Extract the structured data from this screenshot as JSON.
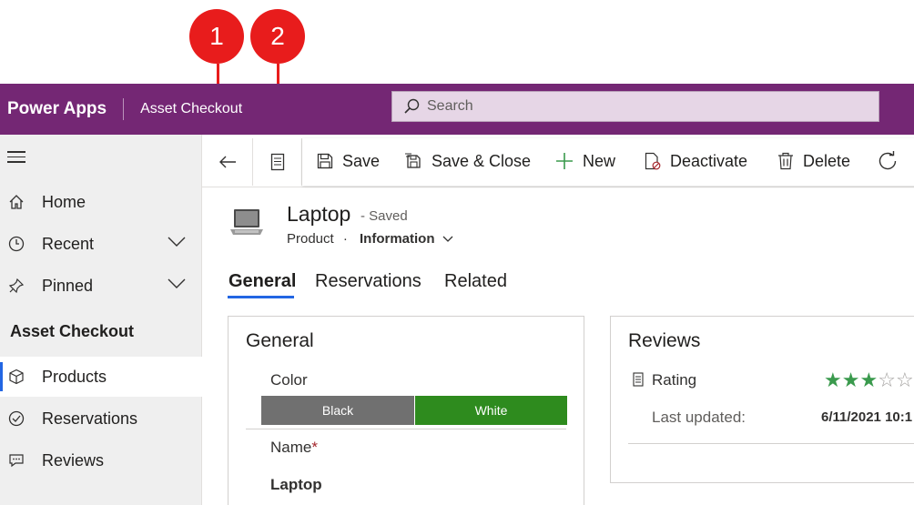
{
  "callouts": [
    "1",
    "2"
  ],
  "header": {
    "app_name": "Power Apps",
    "app_title": "Asset Checkout",
    "search_placeholder": "Search"
  },
  "sidebar": {
    "items": [
      {
        "label": "Home",
        "icon": "home-icon"
      },
      {
        "label": "Recent",
        "icon": "clock-icon"
      },
      {
        "label": "Pinned",
        "icon": "pin-icon"
      }
    ],
    "section_title": "Asset Checkout",
    "section_items": [
      {
        "label": "Products",
        "icon": "cube-icon",
        "active": true
      },
      {
        "label": "Reservations",
        "icon": "check-circle-icon"
      },
      {
        "label": "Reviews",
        "icon": "comment-icon"
      }
    ]
  },
  "command_bar": {
    "save": "Save",
    "save_close": "Save & Close",
    "new": "New",
    "deactivate": "Deactivate",
    "delete": "Delete"
  },
  "record": {
    "title": "Laptop",
    "status": "- Saved",
    "entity": "Product",
    "separator": "·",
    "form_name": "Information"
  },
  "tabs": [
    "General",
    "Reservations",
    "Related"
  ],
  "general_card": {
    "title": "General",
    "color_label": "Color",
    "color_options": [
      "Black",
      "White"
    ],
    "color_selected": "White",
    "name_label": "Name",
    "required_mark": "*",
    "name_value": "Laptop"
  },
  "reviews_card": {
    "title": "Reviews",
    "rating_label": "Rating",
    "rating_value": 3,
    "rating_max": 5,
    "last_updated_label": "Last updated:",
    "last_updated_value": "6/11/2021 10:1"
  },
  "colors": {
    "header": "#742774",
    "accent": "#2266e3",
    "callout": "#e81c1c",
    "option_black": "#707070",
    "option_white": "#2e8b1e",
    "star": "#3a9a4d"
  }
}
